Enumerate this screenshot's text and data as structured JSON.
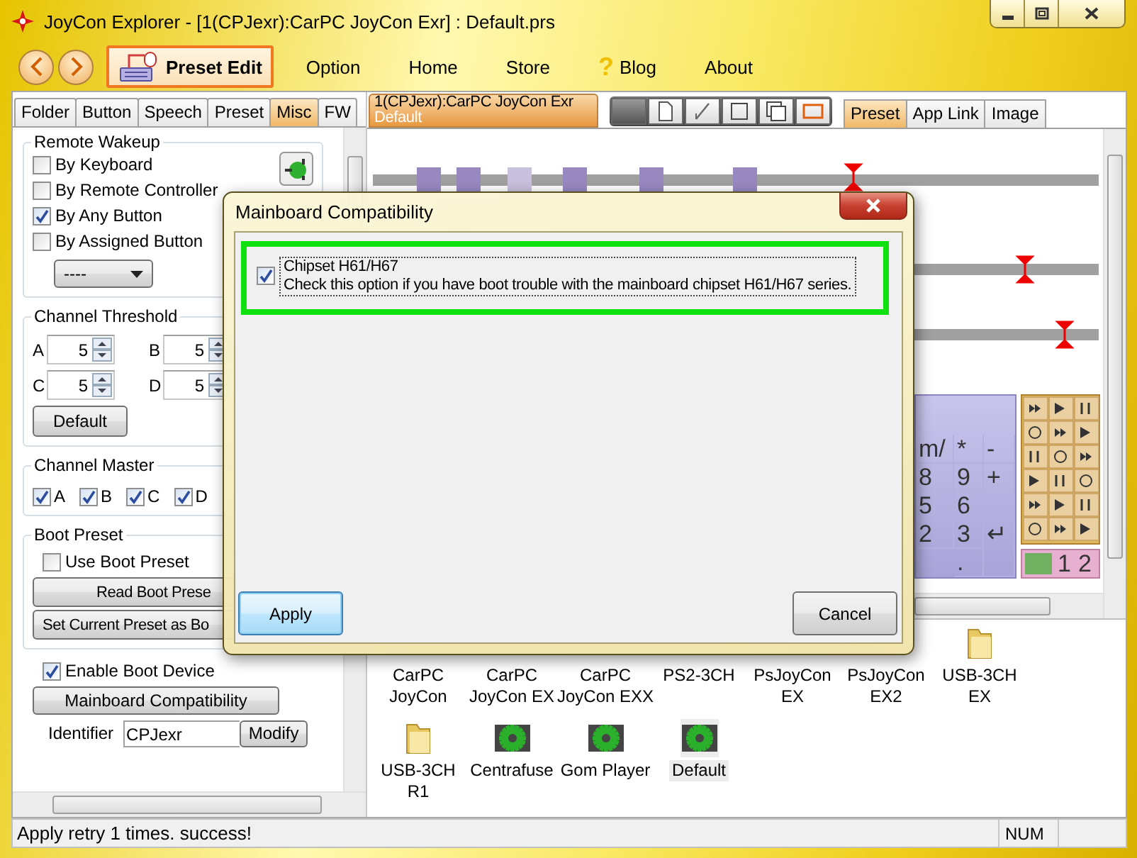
{
  "window": {
    "title": "JoyCon Explorer - [1(CPJexr):CarPC JoyCon Exr] : Default.prs"
  },
  "menu": [
    {
      "label": "Preset Edit",
      "selected": true,
      "kind": "preset"
    },
    {
      "label": "Option",
      "selected": false,
      "kind": "plain"
    },
    {
      "label": "Home",
      "selected": false,
      "kind": "plain"
    },
    {
      "label": "Store",
      "selected": false,
      "kind": "plain"
    },
    {
      "label": "Blog",
      "selected": false,
      "kind": "help",
      "icon": "?"
    },
    {
      "label": "About",
      "selected": false,
      "kind": "plain"
    }
  ],
  "left_tabs": [
    {
      "label": "Folder",
      "selected": false
    },
    {
      "label": "Button",
      "selected": false
    },
    {
      "label": "Speech",
      "selected": false
    },
    {
      "label": "Preset",
      "selected": false
    },
    {
      "label": "Misc",
      "selected": true
    },
    {
      "label": "FW",
      "selected": false
    }
  ],
  "remote_wakeup": {
    "title": "Remote Wakeup",
    "options": [
      {
        "label": "By Keyboard",
        "checked": false
      },
      {
        "label": "By Remote Controller",
        "checked": false
      },
      {
        "label": "By Any Button",
        "checked": true
      },
      {
        "label": "By Assigned Button",
        "checked": false
      }
    ],
    "dropdown": "----"
  },
  "channel_threshold": {
    "title": "Channel Threshold",
    "fields": [
      {
        "label": "A",
        "value": "5"
      },
      {
        "label": "B",
        "value": "5"
      },
      {
        "label": "C",
        "value": "5"
      },
      {
        "label": "D",
        "value": "5"
      }
    ],
    "button": "Default"
  },
  "channel_master": {
    "title": "Channel Master",
    "channels": [
      {
        "label": "A",
        "checked": true
      },
      {
        "label": "B",
        "checked": true
      },
      {
        "label": "C",
        "checked": true
      },
      {
        "label": "D",
        "checked": true
      }
    ]
  },
  "boot_preset": {
    "title": "Boot Preset",
    "use_boot_preset": {
      "label": "Use Boot Preset",
      "checked": false
    },
    "buttons": [
      "Read Boot Prese",
      "Set Current Preset as Bo"
    ]
  },
  "enable_boot_device": {
    "label": "Enable Boot Device",
    "checked": true
  },
  "mainboard_button": "Mainboard Compatibility",
  "identifier": {
    "label": "Identifier",
    "value": "CPJexr",
    "button": "Modify"
  },
  "document_tab": {
    "title": "1(CPJexr):CarPC JoyCon Exr",
    "subtitle": "Default"
  },
  "view_tabs": [
    {
      "label": "Preset",
      "selected": true
    },
    {
      "label": "App Link",
      "selected": false
    },
    {
      "label": "Image",
      "selected": false
    }
  ],
  "keypad": [
    {
      "label": "m/",
      "kind": "key"
    },
    {
      "label": "*",
      "kind": "key"
    },
    {
      "label": "-",
      "kind": "key"
    },
    {
      "label": "8",
      "kind": "key"
    },
    {
      "label": "9",
      "kind": "key"
    },
    {
      "label": "+",
      "kind": "tall"
    },
    {
      "label": "5",
      "kind": "key"
    },
    {
      "label": "6",
      "kind": "key"
    },
    {
      "label": "2",
      "kind": "key"
    },
    {
      "label": "3",
      "kind": "key"
    },
    {
      "label": "↵",
      "kind": "tall"
    },
    {
      "label": ".",
      "kind": "decimal"
    }
  ],
  "button_strip": [
    "1",
    "2"
  ],
  "presets": [
    {
      "label": "CarPC\nJoyCon",
      "kind": "none",
      "selected": false
    },
    {
      "label": "CarPC\nJoyCon EX",
      "kind": "none",
      "selected": false
    },
    {
      "label": "CarPC\nJoyCon EXX",
      "kind": "none",
      "selected": false
    },
    {
      "label": "PS2-3CH",
      "kind": "none",
      "selected": false
    },
    {
      "label": "PsJoyCon\nEX",
      "kind": "none",
      "selected": false
    },
    {
      "label": "PsJoyCon\nEX2",
      "kind": "none",
      "selected": false
    },
    {
      "label": "USB-3CH\nEX",
      "kind": "folder",
      "selected": false
    },
    {
      "label": "USB-3CH\nR1",
      "kind": "folder",
      "selected": false
    },
    {
      "label": "Centrafuse",
      "kind": "preset",
      "selected": false
    },
    {
      "label": "Gom Player",
      "kind": "preset",
      "selected": false
    },
    {
      "label": "Default",
      "kind": "preset",
      "selected": true
    }
  ],
  "status_bar": {
    "message": "Apply retry 1 times. success!",
    "indicator": "NUM"
  },
  "dialog": {
    "title": "Mainboard Compatibility",
    "option": {
      "label": "Chipset H61/H67",
      "description": "Check this option if you have boot trouble with the mainboard chipset H61/H67 series.",
      "checked": true
    },
    "buttons": [
      {
        "label": "Apply",
        "focused": true
      },
      {
        "label": "Cancel",
        "focused": false
      }
    ]
  }
}
